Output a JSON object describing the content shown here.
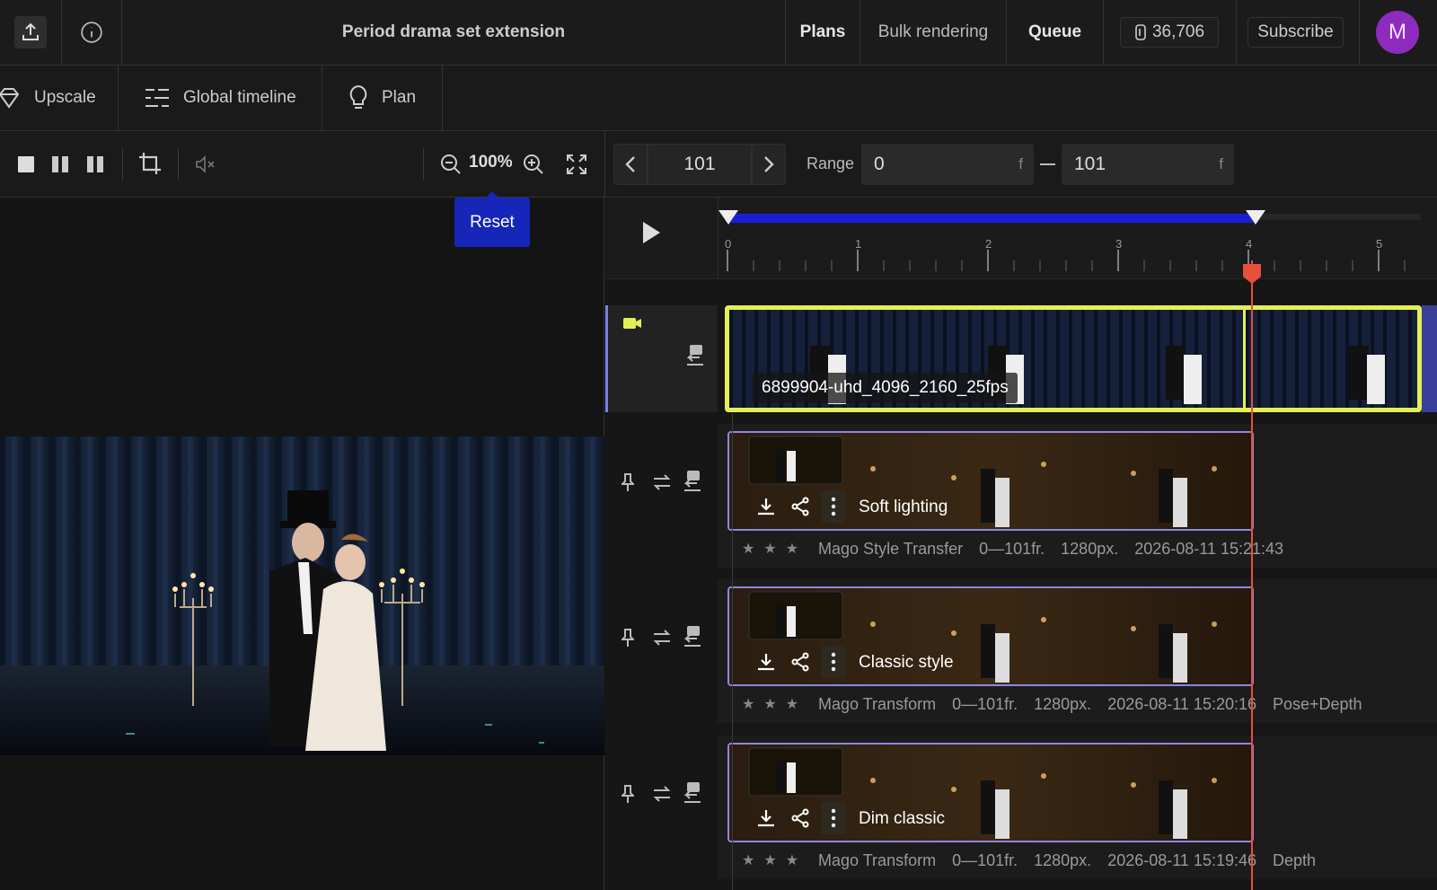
{
  "topbar": {
    "project_title": "Period drama set extension",
    "nav": {
      "plans": "Plans",
      "bulk_rendering": "Bulk rendering",
      "queue": "Queue"
    },
    "credits": "36,706",
    "subscribe": "Subscribe",
    "avatar_initial": "M"
  },
  "tools": {
    "upscale": "Upscale",
    "global_timeline": "Global timeline",
    "plan": "Plan"
  },
  "viewer": {
    "zoom": "100%",
    "reset_tooltip": "Reset"
  },
  "frame": {
    "current": "101",
    "range_label": "Range",
    "range_start": "0",
    "range_end": "101",
    "unit": "f"
  },
  "ruler": {
    "ticks": [
      "0",
      "1",
      "2",
      "3",
      "4",
      "5"
    ]
  },
  "source_clip": {
    "name": "6899904-uhd_4096_2160_25fps"
  },
  "outputs": [
    {
      "name": "Soft lighting",
      "model": "Mago Style Transfer",
      "frames": "0—101fr.",
      "resolution": "1280px.",
      "date": "2026-08-11 15:21:43",
      "extra": ""
    },
    {
      "name": "Classic style",
      "model": "Mago Transform",
      "frames": "0—101fr.",
      "resolution": "1280px.",
      "date": "2026-08-11 15:20:16",
      "extra": "Pose+Depth"
    },
    {
      "name": "Dim classic",
      "model": "Mago Transform",
      "frames": "0—101fr.",
      "resolution": "1280px.",
      "date": "2026-08-11 15:19:46",
      "extra": "Depth"
    }
  ],
  "colors": {
    "accent_blue": "#1a1fd6",
    "playhead_red": "#e8503a",
    "source_outline": "#e4ef57",
    "output_outline": "#8e86e0",
    "avatar": "#8e2bbf"
  }
}
